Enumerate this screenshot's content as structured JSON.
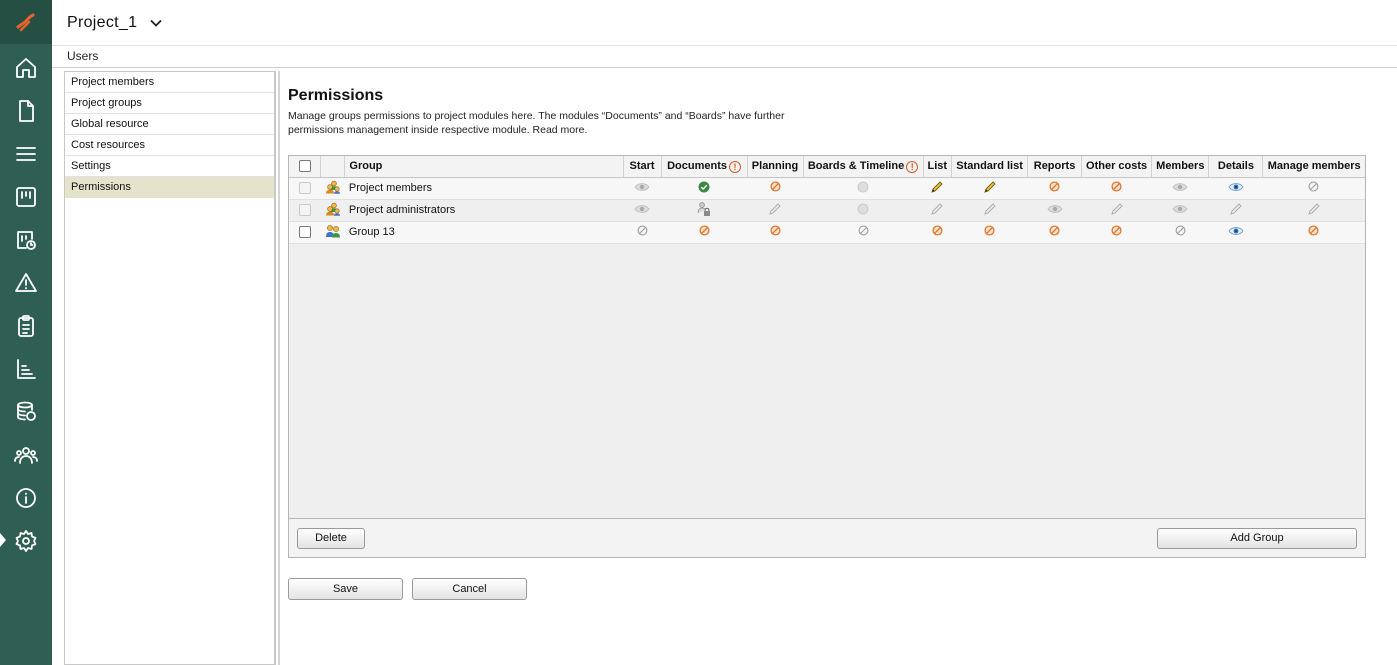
{
  "header": {
    "project_title": "Project_1"
  },
  "breadcrumb": {
    "current": "Users"
  },
  "submenu": {
    "items": [
      {
        "label": "Project members"
      },
      {
        "label": "Project groups"
      },
      {
        "label": "Global resource"
      },
      {
        "label": "Cost resources"
      },
      {
        "label": "Settings"
      },
      {
        "label": "Permissions",
        "active": true
      }
    ]
  },
  "page": {
    "title": "Permissions",
    "description": "Manage groups permissions to project modules here. The modules “Documents” and “Boards” have further permissions management inside respective module. Read more."
  },
  "table": {
    "columns": {
      "group": "Group",
      "start": "Start",
      "documents": "Documents",
      "planning": "Planning",
      "boards": "Boards & Timeline",
      "list": "List",
      "standard_list": "Standard list",
      "reports": "Reports",
      "other_costs": "Other costs",
      "members": "Members",
      "details": "Details",
      "manage_members": "Manage members"
    },
    "info_badge": "!",
    "rows": [
      {
        "name": "Project members",
        "checkbox_disabled": true,
        "icon": "group-users-icon",
        "perms": [
          "view-grey",
          "allowed-green",
          "deny-orange",
          "circle-grey",
          "edit-yellow",
          "edit-yellow",
          "deny-orange",
          "deny-orange",
          "view-grey",
          "view-blue",
          "deny-grey"
        ]
      },
      {
        "name": "Project administrators",
        "checkbox_disabled": true,
        "icon": "group-users-icon",
        "perms": [
          "view-grey",
          "locked-user",
          "edit-grey",
          "circle-grey",
          "edit-grey",
          "edit-grey",
          "view-grey",
          "edit-grey",
          "view-grey",
          "edit-grey",
          "edit-grey"
        ]
      },
      {
        "name": "Group 13",
        "checkbox_disabled": false,
        "icon": "group-people-icon",
        "perms": [
          "deny-grey",
          "deny-orange",
          "deny-orange",
          "deny-grey",
          "deny-orange",
          "deny-orange",
          "deny-orange",
          "deny-orange",
          "deny-grey",
          "view-blue",
          "deny-orange"
        ]
      }
    ]
  },
  "buttons": {
    "delete": "Delete",
    "add_group": "Add Group",
    "save": "Save",
    "cancel": "Cancel"
  },
  "colors": {
    "rail": "#2f5f52",
    "accent_orange": "#e0772e",
    "allowed_green": "#3a8a44",
    "view_blue": "#3b7fc4",
    "active_menu": "#e6e3cc"
  }
}
